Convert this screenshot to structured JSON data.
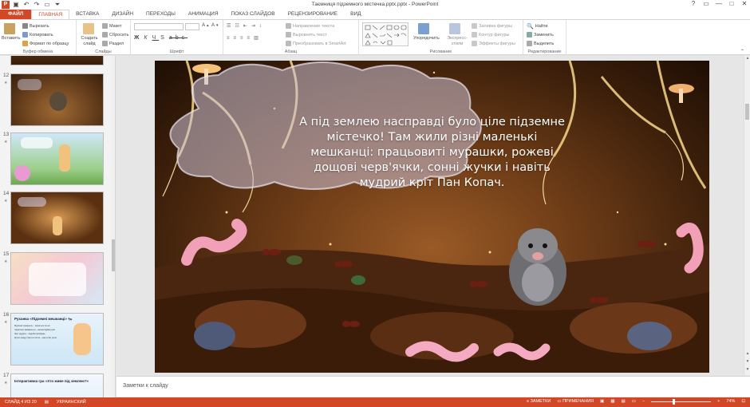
{
  "window": {
    "title": "Таємниця підземного містечка.pptx.pptx - PowerPoint",
    "controls": [
      "?",
      "▭",
      "—",
      "□",
      "✕"
    ]
  },
  "tabs": [
    "ФАЙЛ",
    "ГЛАВНАЯ",
    "ВСТАВКА",
    "ДИЗАЙН",
    "ПЕРЕХОДЫ",
    "АНИМАЦИЯ",
    "ПОКАЗ СЛАЙДОВ",
    "РЕЦЕНЗИРОВАНИЕ",
    "ВИД"
  ],
  "active_tab": "ГЛАВНАЯ",
  "ribbon": {
    "clipboard": {
      "label": "Буфер обмена",
      "paste": "Вставить",
      "cut": "Вырезать",
      "copy": "Копировать",
      "format_painter": "Формат по образцу"
    },
    "slides": {
      "label": "Слайды",
      "new_slide": "Создать слайд",
      "layout": "Макет",
      "reset": "Сбросить",
      "section": "Раздел"
    },
    "font": {
      "label": "Шрифт"
    },
    "paragraph": {
      "label": "Абзац",
      "text_direction": "Направление текста",
      "align_text": "Выровнять текст",
      "smartart": "Преобразовать в SmartArt"
    },
    "drawing": {
      "label": "Рисование",
      "arrange": "Упорядочить",
      "quick_styles": "Экспресс-стили",
      "shape_fill": "Заливка фигуры",
      "shape_outline": "Контур фигуры",
      "shape_effects": "Эффекты фигуры"
    },
    "editing": {
      "label": "Редактирование",
      "find": "Найти",
      "replace": "Заменить",
      "select": "Выделить"
    }
  },
  "thumbnails": [
    {
      "number": "12",
      "star": "★"
    },
    {
      "number": "13",
      "star": "★"
    },
    {
      "number": "14",
      "star": "★"
    },
    {
      "number": "15",
      "star": "★"
    },
    {
      "number": "16",
      "star": "★",
      "title": "Руханка «Підземні мешканці» 🐜",
      "lines": [
        "Мурашкі працюють – зашиться по на",
        "Черв'ячки звиваються – хвилеподібні рухи",
        "Жук трудяга – ходьба присідань",
        "Кроти кладу стати в гостях – мах в бік, ритм"
      ]
    },
    {
      "number": "17",
      "star": "★",
      "title": "Інтерактивна гра «Хто живе під землею?»"
    }
  ],
  "slide": {
    "text": "А під землею насправді було ціле підземне містечко! Там жили різні маленькі мешканці: працьовиті мурашки, рожеві дощові черв'ячки, сонні жучки і навіть мудрий кріт Пан Копач."
  },
  "notes": {
    "placeholder": "Заметки к слайду"
  },
  "status": {
    "slide_of": "СЛАЙД 4 ИЗ 20",
    "language": "УКРАИНСКИЙ",
    "notes_btn": "ЗАМЕТКИ",
    "comments_btn": "ПРИМЕЧАНИЯ",
    "zoom": "74%",
    "zoom_fraction": 0.74
  },
  "colors": {
    "accent": "#d24726",
    "thumb_border_selected": "#e07a5f"
  }
}
